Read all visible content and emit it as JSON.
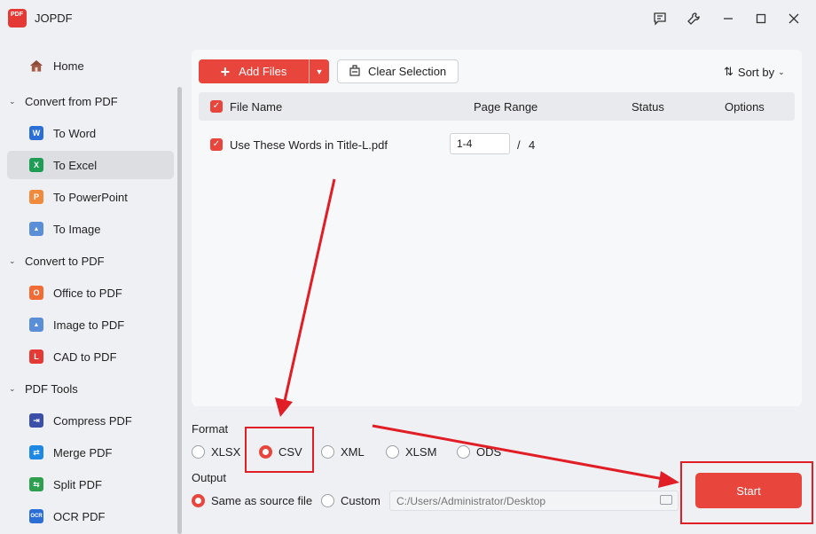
{
  "app": {
    "title": "JOPDF",
    "logo_text": "PDF"
  },
  "window_controls": [
    "feedback-icon",
    "settings-icon",
    "minimize-icon",
    "maximize-icon",
    "close-icon"
  ],
  "sidebar": {
    "home": {
      "label": "Home",
      "icon": "home-icon"
    },
    "groups": [
      {
        "label": "Convert from PDF",
        "items": [
          {
            "label": "To Word",
            "icon": "word-icon",
            "icon_letter": "W",
            "color": "#2b6fd6"
          },
          {
            "label": "To Excel",
            "icon": "excel-icon",
            "icon_letter": "X",
            "color": "#1f9d55",
            "active": true
          },
          {
            "label": "To PowerPoint",
            "icon": "powerpoint-icon",
            "icon_letter": "P",
            "color": "#f08a3c"
          },
          {
            "label": "To Image",
            "icon": "image-icon",
            "icon_letter": "▲",
            "color": "#5a8fd8"
          }
        ]
      },
      {
        "label": "Convert to PDF",
        "items": [
          {
            "label": "Office to PDF",
            "icon": "office-icon",
            "icon_letter": "O",
            "color": "#f06b35"
          },
          {
            "label": "Image to PDF",
            "icon": "image-icon",
            "icon_letter": "▲",
            "color": "#5a8fd8"
          },
          {
            "label": "CAD to PDF",
            "icon": "cad-icon",
            "icon_letter": "L",
            "color": "#e53935"
          }
        ]
      },
      {
        "label": "PDF Tools",
        "items": [
          {
            "label": "Compress PDF",
            "icon": "compress-icon",
            "icon_letter": "⇥",
            "color": "#3b4fa8"
          },
          {
            "label": "Merge PDF",
            "icon": "merge-icon",
            "icon_letter": "⇄",
            "color": "#1e88e5"
          },
          {
            "label": "Split PDF",
            "icon": "split-icon",
            "icon_letter": "⇆",
            "color": "#2e9e4f"
          },
          {
            "label": "OCR PDF",
            "icon": "ocr-icon",
            "icon_letter": "OCR",
            "color": "#2b6fd6"
          }
        ]
      }
    ]
  },
  "toolbar": {
    "add_files_label": "Add Files",
    "clear_selection_label": "Clear Selection",
    "sort_label": "Sort by"
  },
  "table": {
    "headers": {
      "file_name": "File Name",
      "page_range": "Page Range",
      "status": "Status",
      "options": "Options"
    },
    "rows": [
      {
        "file_name": "Use These Words in Title-L.pdf",
        "page_range": "1-4",
        "separator": "/",
        "total_pages": "4",
        "checked": true
      }
    ]
  },
  "format": {
    "label": "Format",
    "options": [
      "XLSX",
      "CSV",
      "XML",
      "XLSM",
      "ODS"
    ],
    "selected": "CSV"
  },
  "output": {
    "label": "Output",
    "options": [
      "Same as source file",
      "Custom"
    ],
    "selected": "Same as source file",
    "path_placeholder": "C:/Users/Administrator/Desktop"
  },
  "start_label": "Start",
  "colors": {
    "accent": "#e8453c",
    "annotation": "#e11d25"
  }
}
